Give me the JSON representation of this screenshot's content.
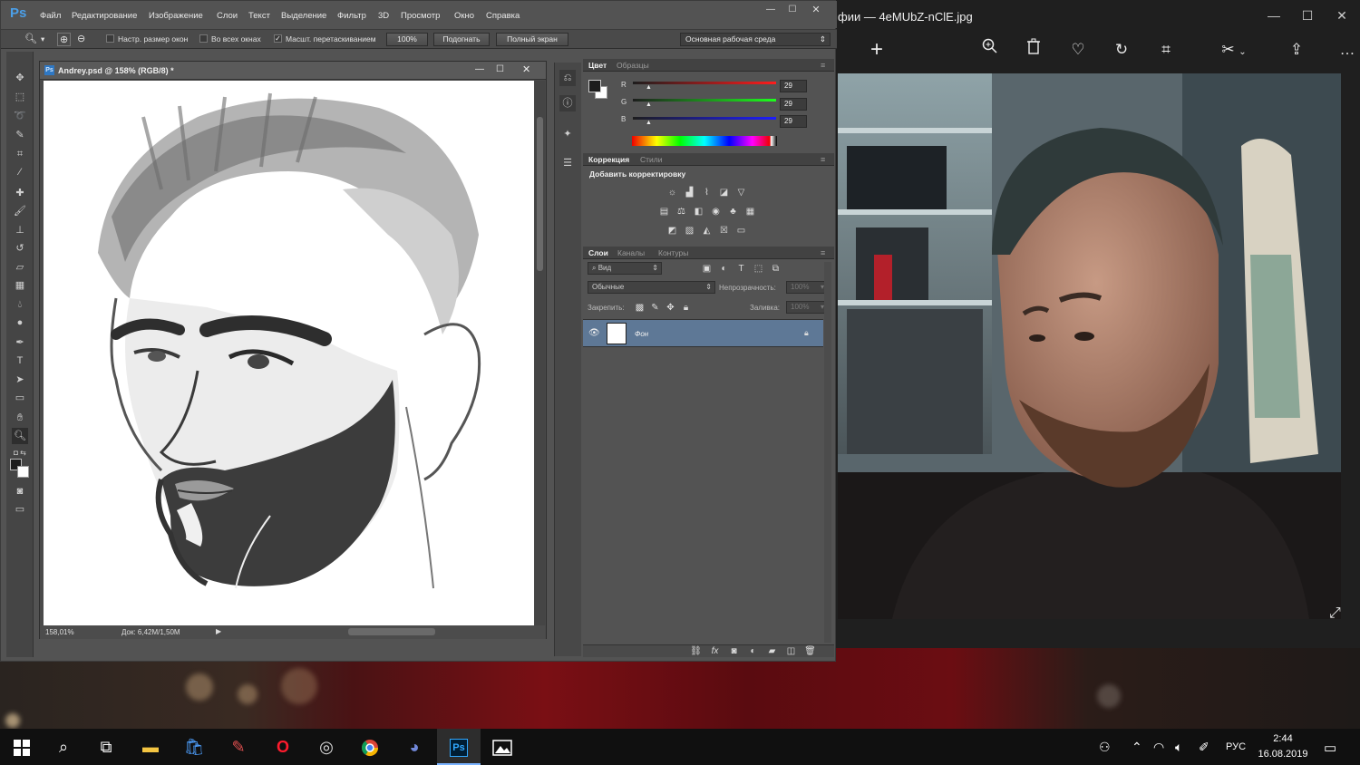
{
  "photoshop": {
    "logo": "Ps",
    "menu": [
      "Файл",
      "Редактирование",
      "Изображение",
      "Слои",
      "Текст",
      "Выделение",
      "Фильтр",
      "3D",
      "Просмотр",
      "Окно",
      "Справка"
    ],
    "options": {
      "resize_windows": "Настр. размер окон",
      "all_windows": "Во всех окнах",
      "scrubby_zoom": "Масшт. перетаскиванием",
      "zoom_value": "100%",
      "fit_button": "Подогнать",
      "fullscreen_button": "Полный экран",
      "workspace": "Основная рабочая среда"
    },
    "document": {
      "title": "Andrey.psd @ 158% (RGB/8) *",
      "zoom": "158,01%",
      "doc_size": "Док: 6,42M/1,50M"
    },
    "color_panel": {
      "tabs": [
        "Цвет",
        "Образцы"
      ],
      "r_label": "R",
      "g_label": "G",
      "b_label": "B",
      "r": "29",
      "g": "29",
      "b": "29",
      "foreground": "#1d1d1d",
      "background": "#ffffff"
    },
    "adjustments_panel": {
      "tabs": [
        "Коррекция",
        "Стили"
      ],
      "heading": "Добавить корректировку"
    },
    "layers_panel": {
      "tabs": [
        "Слои",
        "Каналы",
        "Контуры"
      ],
      "filter": "Вид",
      "blend_mode": "Обычные",
      "opacity_label": "Непрозрачность:",
      "opacity": "100%",
      "lock_label": "Закрепить:",
      "fill_label": "Заливка:",
      "fill": "100%",
      "layers": [
        {
          "name": "Фон",
          "visible": true,
          "locked": true
        }
      ]
    }
  },
  "viewer": {
    "title": "фии — 4eMUbZ-nClE.jpg"
  },
  "taskbar": {
    "language": "РУС",
    "time": "2:44",
    "date": "16.08.2019"
  }
}
